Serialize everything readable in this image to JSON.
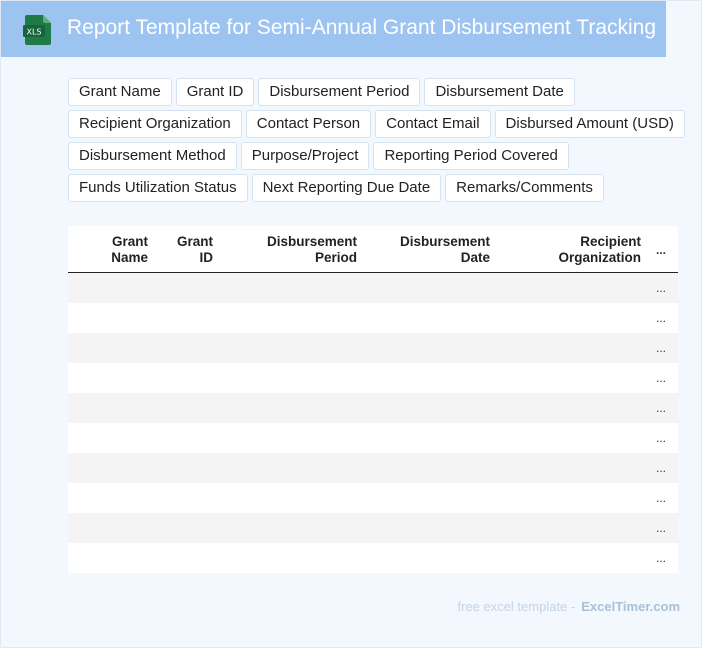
{
  "header": {
    "icon_label": "XLS",
    "title": "Report Template for Semi-Annual Grant Disbursement Tracking"
  },
  "fields": [
    [
      "Grant Name",
      "Grant ID",
      "Disbursement Period",
      "Disbursement Date"
    ],
    [
      "Recipient Organization",
      "Contact Person",
      "Contact Email",
      "Disbursed Amount (USD)"
    ],
    [
      "Disbursement Method",
      "Purpose/Project",
      "Reporting Period Covered"
    ],
    [
      "Funds Utilization Status",
      "Next Reporting Due Date",
      "Remarks/Comments"
    ]
  ],
  "table": {
    "columns": [
      {
        "line1": "Grant",
        "line2": "Name"
      },
      {
        "line1": "Grant",
        "line2": "ID"
      },
      {
        "line1": "Disbursement",
        "line2": "Period"
      },
      {
        "line1": "Disbursement",
        "line2": "Date"
      },
      {
        "line1": "Recipient",
        "line2": "Organization"
      }
    ],
    "overflow_marker": "...",
    "row_count": 10
  },
  "footer": {
    "text": "free excel template -",
    "brand": "ExcelTimer.com"
  },
  "colors": {
    "header_bg": "#9dc4f0",
    "icon_green": "#1e7b45",
    "page_bg": "#f3f8fe"
  }
}
